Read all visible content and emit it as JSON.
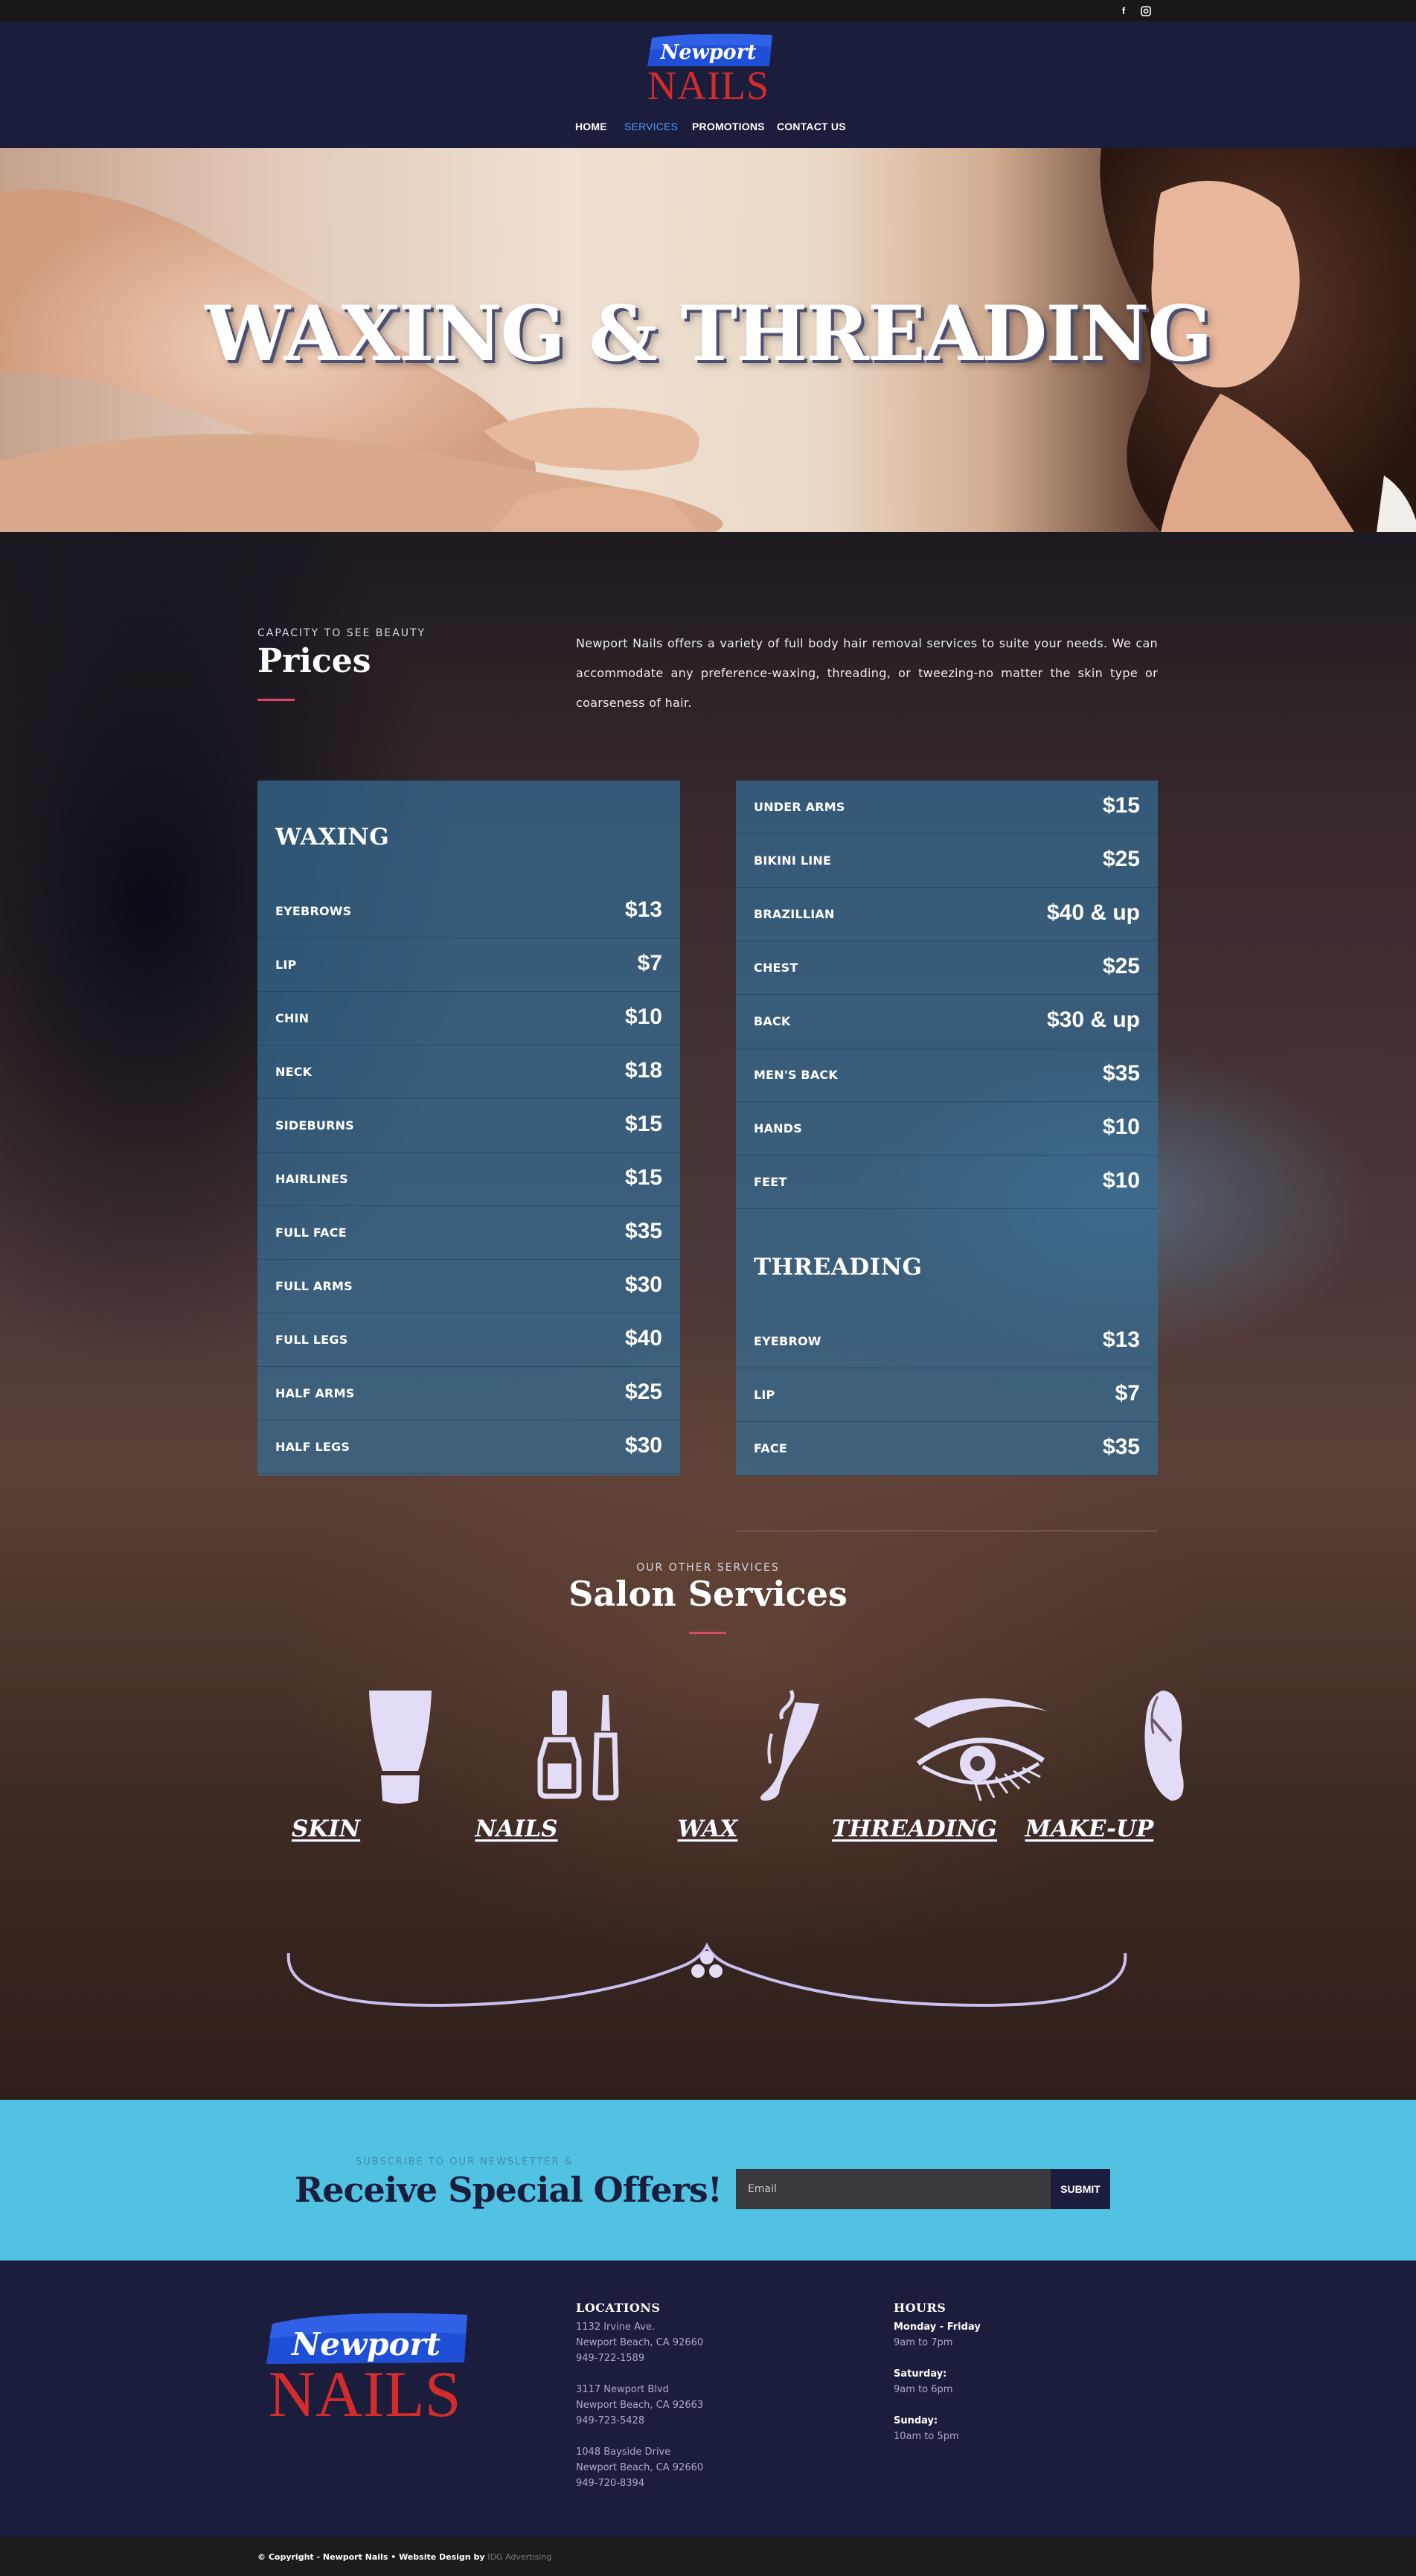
{
  "social": {
    "facebook_glyph": "f",
    "instagram_glyph": "◘"
  },
  "logo": {
    "script_text": "Newport",
    "block_text": "NAILS",
    "colors": {
      "blue": "#1f4fd6",
      "red": "#d52b2b"
    }
  },
  "nav": {
    "items": [
      {
        "label": "HOME",
        "active": false
      },
      {
        "label": "SERVICES",
        "active": true
      },
      {
        "label": "PROMOTIONS",
        "active": false
      },
      {
        "label": "CONTACT US",
        "active": false
      }
    ],
    "active_color": "#4e97f3"
  },
  "hero": {
    "title": "WAXING & THREADING"
  },
  "prices": {
    "eyebrow": "CAPACITY TO SEE BEAUTY",
    "title": "Prices",
    "intro": "Newport Nails offers a variety of full body hair removal services to suite your needs. We can accommodate any preference-waxing, threading, or tweezing-no matter the skin type or coarseness of hair.",
    "waxing_heading": "WAXING",
    "waxing": [
      {
        "label": "EYEBROWS",
        "price": "$13"
      },
      {
        "label": "LIP",
        "price": "$7"
      },
      {
        "label": "CHIN",
        "price": "$10"
      },
      {
        "label": "NECK",
        "price": "$18"
      },
      {
        "label": "SIDEBURNS",
        "price": "$15"
      },
      {
        "label": "HAIRLINES",
        "price": "$15"
      },
      {
        "label": "FULL FACE",
        "price": "$35"
      },
      {
        "label": "FULL ARMS",
        "price": "$30"
      },
      {
        "label": "FULL LEGS",
        "price": "$40"
      },
      {
        "label": "HALF ARMS",
        "price": "$25"
      },
      {
        "label": "HALF LEGS",
        "price": "$30"
      }
    ],
    "waxing_more": [
      {
        "label": "UNDER ARMS",
        "price": "$15"
      },
      {
        "label": "BIKINI LINE",
        "price": "$25"
      },
      {
        "label": "BRAZILLIAN",
        "price": "$40 & up"
      },
      {
        "label": "CHEST",
        "price": "$25"
      },
      {
        "label": "BACK",
        "price": "$30 & up"
      },
      {
        "label": "MEN'S BACK",
        "price": "$35"
      },
      {
        "label": "HANDS",
        "price": "$10"
      },
      {
        "label": "FEET",
        "price": "$10"
      }
    ],
    "threading_heading": "THREADING",
    "threading": [
      {
        "label": "EYEBROW",
        "price": "$13"
      },
      {
        "label": "LIP",
        "price": "$7"
      },
      {
        "label": "FACE",
        "price": "$35"
      }
    ]
  },
  "services": {
    "eyebrow": "OUR OTHER SERVICES",
    "title": "Salon Services",
    "items": [
      {
        "label": "SKIN",
        "icon": "lotion-tube-icon"
      },
      {
        "label": "NAILS",
        "icon": "nail-polish-icon"
      },
      {
        "label": "WAX",
        "icon": "wax-leg-icon"
      },
      {
        "label": "THREADING",
        "icon": "eye-lash-icon"
      },
      {
        "label": "MAKE-UP",
        "icon": "makeup-face-icon"
      }
    ],
    "icon_color": "#e2dcf6"
  },
  "newsletter": {
    "eyebrow": "SUBSCRIBE TO OUR NEWSLETTER &",
    "title": "Receive Special Offers!",
    "email_placeholder": "Email",
    "submit_label": "SUBMIT",
    "background": "#52c2e3"
  },
  "footer": {
    "locations_heading": "LOCATIONS",
    "locations": [
      [
        "1132 Irvine Ave.",
        "Newport Beach, CA 92660",
        "949-722-1589"
      ],
      [
        "3117 Newport Blvd",
        "Newport Beach, CA 92663",
        "949-723-5428"
      ],
      [
        "1048 Bayside Drive",
        "Newport Beach, CA 92660",
        "949-720-8394"
      ]
    ],
    "hours_heading": "HOURS",
    "hours": [
      {
        "day": "Monday - Friday",
        "time": "9am to 7pm"
      },
      {
        "day": "Saturday:",
        "time": "9am to 6pm"
      },
      {
        "day": "Sunday:",
        "time": "10am to 5pm"
      }
    ]
  },
  "copyright": {
    "text": "© Copyright - Newport Nails • Website Design by ",
    "link": "IDG Advertising"
  }
}
